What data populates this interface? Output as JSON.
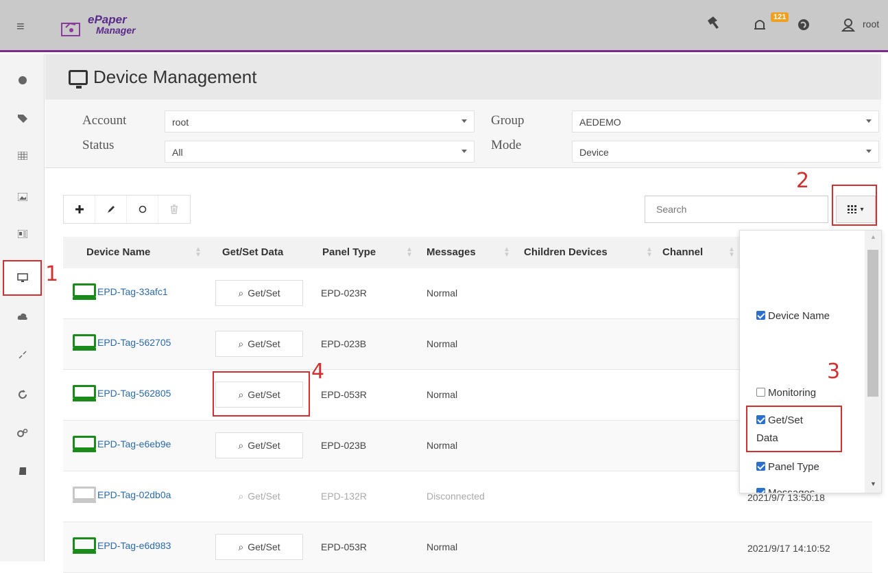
{
  "topbar": {
    "logo_line1": "ePaper",
    "logo_line2": "Manager",
    "notification_count": "121",
    "username": "root"
  },
  "page": {
    "title": "Device Management"
  },
  "filters": {
    "account_label": "Account",
    "account_value": "root",
    "group_label": "Group",
    "group_value": "AEDEMO",
    "status_label": "Status",
    "status_value": "All",
    "mode_label": "Mode",
    "mode_value": "Device"
  },
  "search": {
    "placeholder": "Search"
  },
  "table": {
    "headers": [
      "Device Name",
      "Get/Set Data",
      "Panel Type",
      "Messages",
      "Children Devices",
      "Channel"
    ],
    "rows": [
      {
        "name": "EPD-Tag-33afc1",
        "action": "Get/Set",
        "panel": "EPD-023R",
        "message": "Normal"
      },
      {
        "name": "EPD-Tag-562705",
        "action": "Get/Set",
        "panel": "EPD-023B",
        "message": "Normal"
      },
      {
        "name": "EPD-Tag-562805",
        "action": "Get/Set",
        "panel": "EPD-053R",
        "message": "Normal"
      },
      {
        "name": "EPD-Tag-e6eb9e",
        "action": "Get/Set",
        "panel": "EPD-023B",
        "message": "Normal"
      },
      {
        "name": "EPD-Tag-02db0a",
        "action": "Get/Set",
        "panel": "EPD-132R",
        "message": "Disconnected",
        "time": "2021/9/7 13:50:18"
      },
      {
        "name": "EPD-Tag-e6d983",
        "action": "Get/Set",
        "panel": "EPD-053R",
        "message": "Normal",
        "time": "2021/9/17 14:10:52"
      }
    ]
  },
  "column_menu": {
    "items": [
      {
        "label": "Device Name",
        "checked": true
      },
      {
        "label": "Monitoring",
        "checked": false
      },
      {
        "label": "Get/Set Data",
        "checked": true
      },
      {
        "label": "Panel Type",
        "checked": true
      },
      {
        "label": "Messages",
        "checked": true
      }
    ]
  },
  "annotations": [
    "1",
    "2",
    "3",
    "4"
  ],
  "colors": {
    "accent_purple": "#7a2a8a",
    "highlight_red": "#d32f2f",
    "online_green": "#1a8a1a",
    "link_blue": "#2a6aa8",
    "check_blue": "#2b6fcf"
  }
}
